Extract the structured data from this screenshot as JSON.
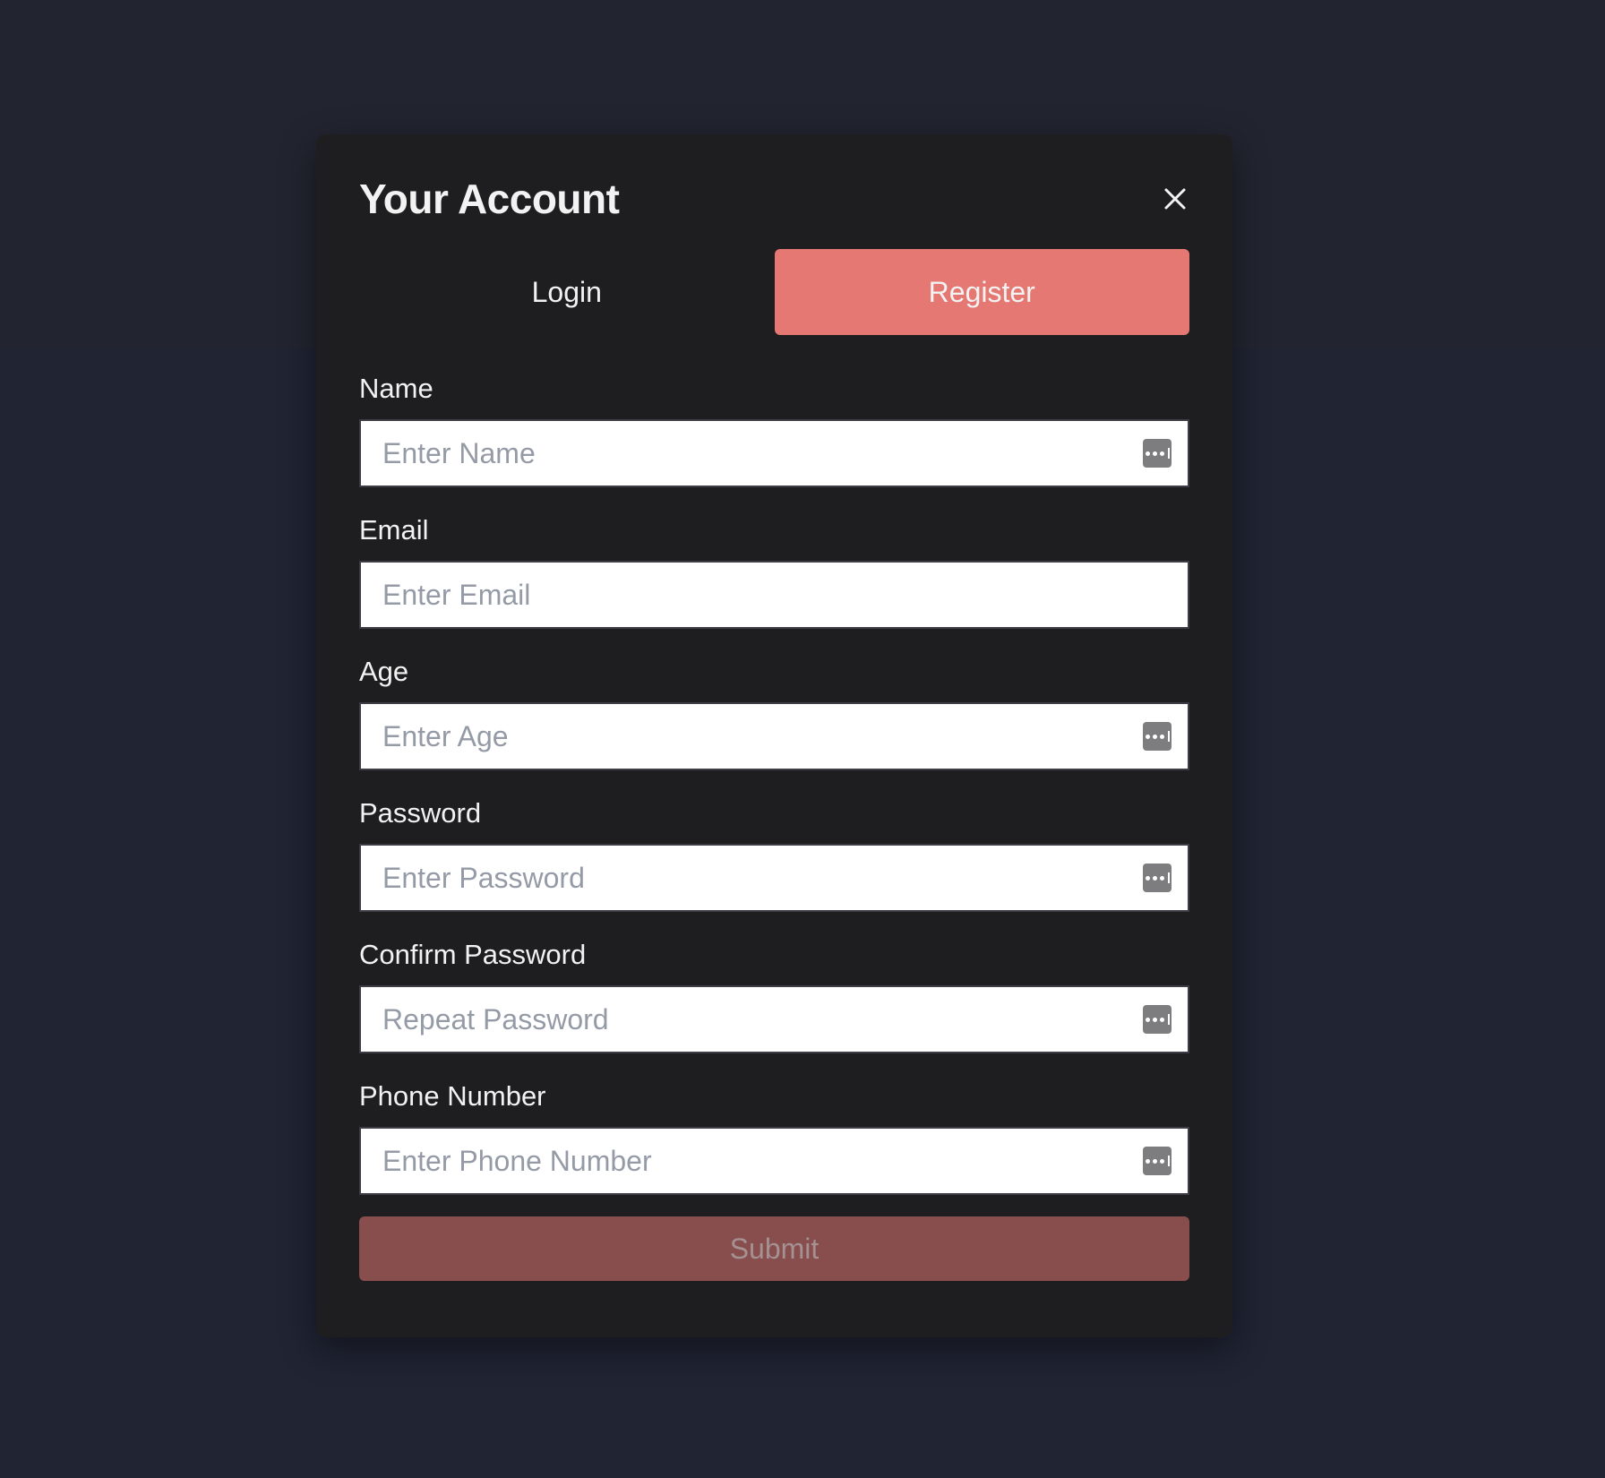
{
  "modal": {
    "title": "Your Account",
    "close_icon": "close-icon"
  },
  "tabs": [
    {
      "label": "Login",
      "active": false
    },
    {
      "label": "Register",
      "active": true
    }
  ],
  "form": {
    "fields": [
      {
        "label": "Name",
        "placeholder": "Enter Name",
        "value": "",
        "has_key_icon": true
      },
      {
        "label": "Email",
        "placeholder": "Enter Email",
        "value": "",
        "has_key_icon": false
      },
      {
        "label": "Age",
        "placeholder": "Enter Age",
        "value": "",
        "has_key_icon": true
      },
      {
        "label": "Password",
        "placeholder": "Enter Password",
        "value": "",
        "has_key_icon": true
      },
      {
        "label": "Confirm Password",
        "placeholder": "Repeat Password",
        "value": "",
        "has_key_icon": true
      },
      {
        "label": "Phone Number",
        "placeholder": "Enter Phone Number",
        "value": "",
        "has_key_icon": true
      }
    ],
    "submit_label": "Submit"
  },
  "colors": {
    "page_background": "#202433",
    "modal_background": "#1e1e20",
    "accent": "#e57872",
    "submit_disabled": "#884d4d"
  }
}
